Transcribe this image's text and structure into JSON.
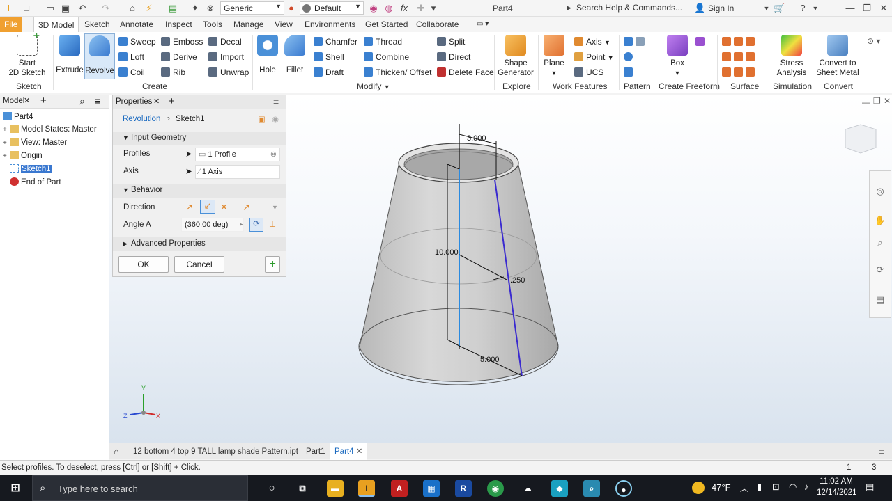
{
  "app": {
    "document_title": "Part4",
    "search_placeholder": "Search Help & Commands...",
    "sign_in": "Sign In",
    "material": "Generic",
    "appearance": "Default"
  },
  "tabs": [
    {
      "label": "File"
    },
    {
      "label": "3D Model"
    },
    {
      "label": "Sketch"
    },
    {
      "label": "Annotate"
    },
    {
      "label": "Inspect"
    },
    {
      "label": "Tools"
    },
    {
      "label": "Manage"
    },
    {
      "label": "View"
    },
    {
      "label": "Environments"
    },
    {
      "label": "Get Started"
    },
    {
      "label": "Collaborate"
    }
  ],
  "ribbon": {
    "sketch": {
      "start_line1": "Start",
      "start_line2": "2D Sketch",
      "panel": "Sketch"
    },
    "create": {
      "extrude": "Extrude",
      "revolve": "Revolve",
      "sweep": "Sweep",
      "loft": "Loft",
      "coil": "Coil",
      "emboss": "Emboss",
      "derive": "Derive",
      "rib": "Rib",
      "decal": "Decal",
      "import": "Import",
      "unwrap": "Unwrap",
      "panel": "Create"
    },
    "modify": {
      "hole": "Hole",
      "fillet": "Fillet",
      "chamfer": "Chamfer",
      "shell": "Shell",
      "draft": "Draft",
      "thread": "Thread",
      "combine": "Combine",
      "thicken": "Thicken/ Offset",
      "split": "Split",
      "direct": "Direct",
      "delete_face": "Delete Face",
      "panel": "Modify"
    },
    "explore": {
      "shape_line1": "Shape",
      "shape_line2": "Generator",
      "panel": "Explore"
    },
    "work": {
      "plane": "Plane",
      "axis": "Axis",
      "point": "Point",
      "ucs": "UCS",
      "panel": "Work Features"
    },
    "pattern": {
      "panel": "Pattern"
    },
    "freeform": {
      "box": "Box",
      "panel": "Create Freeform"
    },
    "surface": {
      "panel": "Surface"
    },
    "simulation": {
      "stress_line1": "Stress",
      "stress_line2": "Analysis",
      "panel": "Simulation"
    },
    "convert": {
      "line1": "Convert to",
      "line2": "Sheet Metal",
      "panel": "Convert"
    }
  },
  "browser": {
    "tab": "Model",
    "items": [
      {
        "label": "Part4"
      },
      {
        "label": "Model States: Master"
      },
      {
        "label": "View: Master"
      },
      {
        "label": "Origin"
      },
      {
        "label": "Sketch1"
      },
      {
        "label": "End of Part"
      }
    ]
  },
  "properties": {
    "title": "Properties",
    "breadcrumb_feature": "Revolution",
    "breadcrumb_sketch": "Sketch1",
    "input_geometry": "Input Geometry",
    "profiles_label": "Profiles",
    "profiles_value": "1 Profile",
    "axis_label": "Axis",
    "axis_value": "1 Axis",
    "behavior": "Behavior",
    "direction_label": "Direction",
    "angle_label": "Angle A",
    "angle_value": "(360.00 deg)",
    "advanced": "Advanced Properties",
    "ok": "OK",
    "cancel": "Cancel"
  },
  "model": {
    "dim_top": "3.000",
    "dim_height": "10.000",
    "dim_thickness": ".250",
    "dim_bottom": "5.000"
  },
  "doc_tabs": [
    {
      "label": "12 bottom 4 top 9 TALL  lamp shade Pattern.ipt"
    },
    {
      "label": "Part1"
    },
    {
      "label": "Part4"
    }
  ],
  "status": {
    "message": "Select profiles. To deselect, press [Ctrl] or [Shift] + Click.",
    "count1": "1",
    "count2": "3"
  },
  "taskbar": {
    "search": "Type here to search",
    "temp": "47°F",
    "time": "11:02 AM",
    "date": "12/14/2021"
  }
}
